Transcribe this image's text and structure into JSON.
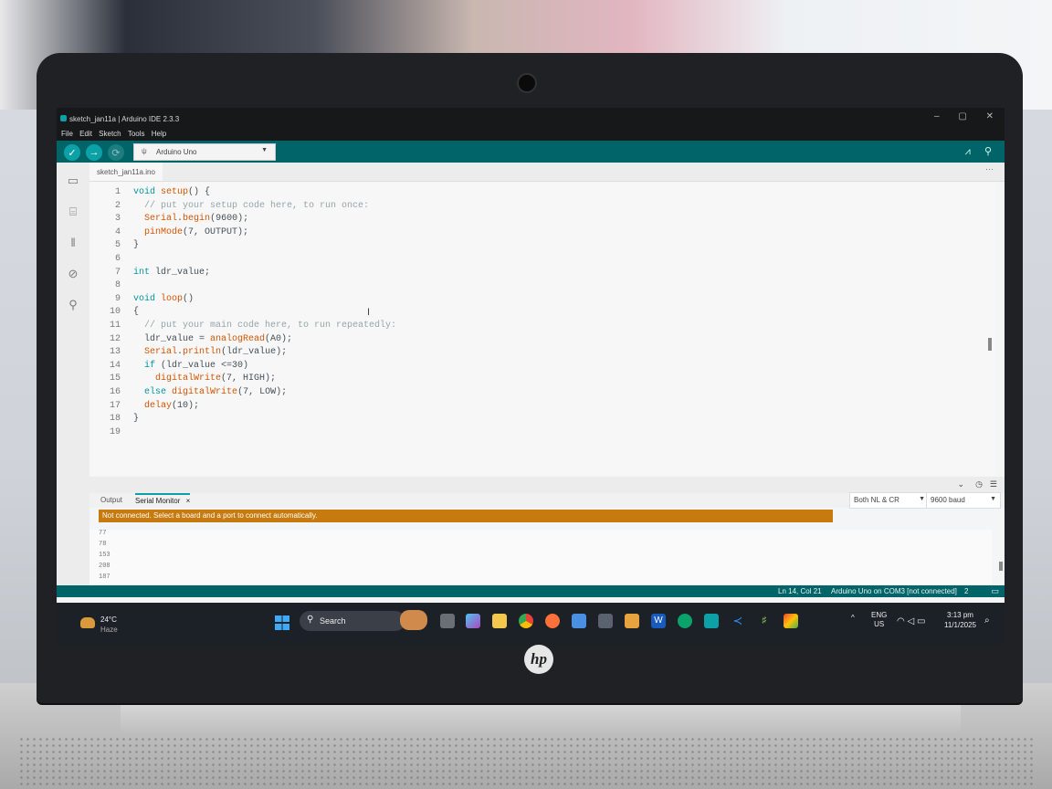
{
  "window": {
    "title": "sketch_jan11a | Arduino IDE 2.3.3",
    "controls": [
      "–",
      "▢",
      "✕"
    ]
  },
  "menu": [
    "File",
    "Edit",
    "Sketch",
    "Tools",
    "Help"
  ],
  "toolbar": {
    "verify_icon": "check-icon",
    "upload_icon": "arrow-right-icon",
    "debug_icon": "debug-icon",
    "board": "Arduino Uno",
    "serial_plotter_icon": "plotter-icon",
    "serial_monitor_icon": "magnifier-icon"
  },
  "sidebar": [
    "folder-icon",
    "board-icon",
    "library-icon",
    "debug-icon",
    "search-icon"
  ],
  "editor": {
    "tab": "sketch_jan11a.ino",
    "lines": [
      {
        "n": "1",
        "t": "void setup() {"
      },
      {
        "n": "2",
        "t": "  // put your setup code here, to run once:"
      },
      {
        "n": "3",
        "t": "  Serial.begin(9600);"
      },
      {
        "n": "4",
        "t": "  pinMode(7, OUTPUT);"
      },
      {
        "n": "5",
        "t": "}"
      },
      {
        "n": "6",
        "t": ""
      },
      {
        "n": "7",
        "t": "int ldr_value;"
      },
      {
        "n": "8",
        "t": ""
      },
      {
        "n": "9",
        "t": "void loop()"
      },
      {
        "n": "10",
        "t": "{"
      },
      {
        "n": "11",
        "t": "  // put your main code here, to run repeatedly:"
      },
      {
        "n": "12",
        "t": "  ldr_value = analogRead(A0);"
      },
      {
        "n": "13",
        "t": "  Serial.println(ldr_value);"
      },
      {
        "n": "14",
        "t": "  if (ldr_value <=30)"
      },
      {
        "n": "15",
        "t": "    digitalWrite(7, HIGH);"
      },
      {
        "n": "16",
        "t": "  else digitalWrite(7, LOW);"
      },
      {
        "n": "17",
        "t": "  delay(10);"
      },
      {
        "n": "18",
        "t": "}"
      },
      {
        "n": "19",
        "t": ""
      }
    ]
  },
  "bottom_panel": {
    "tabs": [
      "Output",
      "Serial Monitor"
    ],
    "close": "×",
    "line_ending": "Both NL & CR",
    "baud": "9600 baud",
    "warning": "Not connected. Select a board and a port to connect automatically.",
    "serial_values": [
      "77",
      "78",
      "153",
      "208",
      "187"
    ]
  },
  "status": {
    "position": "Ln 14, Col 21",
    "board": "Arduino Uno on COM3 [not connected]",
    "notifications": "2"
  },
  "taskbar": {
    "temp": "24°C",
    "weather": "Haze",
    "search": "Search",
    "lang1": "ENG",
    "lang2": "US",
    "time": "3:13 pm",
    "date": "11/1/2025"
  },
  "brand": "hp"
}
